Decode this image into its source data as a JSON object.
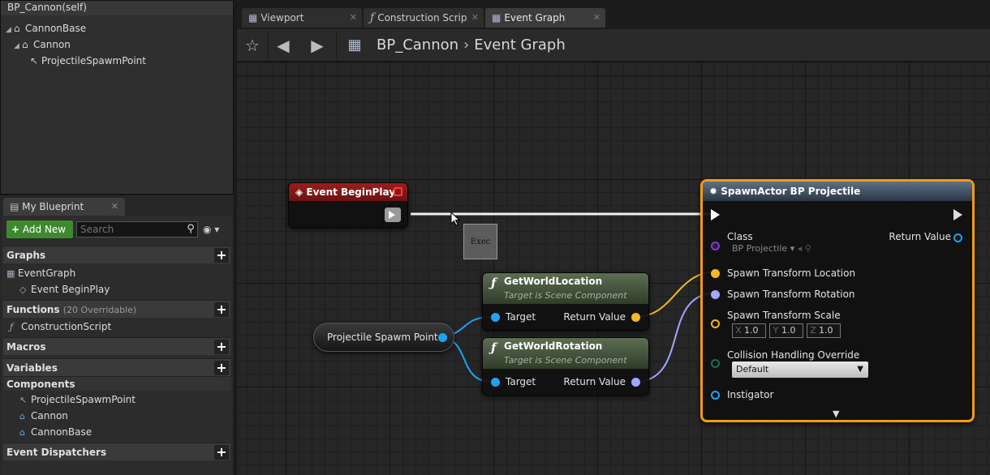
{
  "components": {
    "self_label": "BP_Cannon(self)",
    "tree": [
      {
        "label": "CannonBase"
      },
      {
        "label": "Cannon"
      },
      {
        "label": "ProjectileSpawmPoint"
      }
    ]
  },
  "my_blueprint": {
    "tab_label": "My Blueprint",
    "add_new_label": "Add New",
    "search_placeholder": "Search",
    "sections": {
      "graphs": "Graphs",
      "functions": "Functions",
      "functions_sub": "(20 Overridable)",
      "macros": "Macros",
      "variables": "Variables",
      "components": "Components",
      "event_dispatchers": "Event Dispatchers"
    },
    "graph_items": [
      "EventGraph",
      "Event BeginPlay"
    ],
    "function_items": [
      "ConstructionScript"
    ],
    "component_items": [
      "ProjectileSpawmPoint",
      "Cannon",
      "CannonBase"
    ]
  },
  "tabs": [
    {
      "label": "Viewport"
    },
    {
      "label": "Construction Scrip"
    },
    {
      "label": "Event Graph"
    }
  ],
  "breadcrumb": {
    "blueprint": "BP_Cannon",
    "graph": "Event Graph"
  },
  "nodes": {
    "begin_play": {
      "title": "Event BeginPlay"
    },
    "tooltip": "Exec",
    "get_world_location": {
      "title": "GetWorldLocation",
      "subtitle": "Target is Scene Component",
      "in_pin": "Target",
      "out_pin": "Return Value"
    },
    "get_world_rotation": {
      "title": "GetWorldRotation",
      "subtitle": "Target is Scene Component",
      "in_pin": "Target",
      "out_pin": "Return Value"
    },
    "variable": {
      "label": "Projectile Spawm Point"
    },
    "spawn_actor": {
      "title": "SpawnActor BP Projectile",
      "class_label": "Class",
      "class_value": "BP Projectile",
      "return_value": "Return Value",
      "spawn_location": "Spawn Transform Location",
      "spawn_rotation": "Spawn Transform Rotation",
      "spawn_scale": "Spawn Transform Scale",
      "scale_x_label": "X",
      "scale_x": "1.0",
      "scale_y_label": "Y",
      "scale_y": "1.0",
      "scale_z_label": "Z",
      "scale_z": "1.0",
      "collision_label": "Collision Handling Override",
      "collision_value": "Default",
      "instigator": "Instigator"
    }
  },
  "colors": {
    "exec_wire": "#ffffff",
    "vector_pin": "#f5b81f",
    "rotator_pin": "#a3a6ff",
    "object_pin": "#1fa2f5",
    "selection": "#f59b13",
    "add_new": "#3d8a2e"
  }
}
